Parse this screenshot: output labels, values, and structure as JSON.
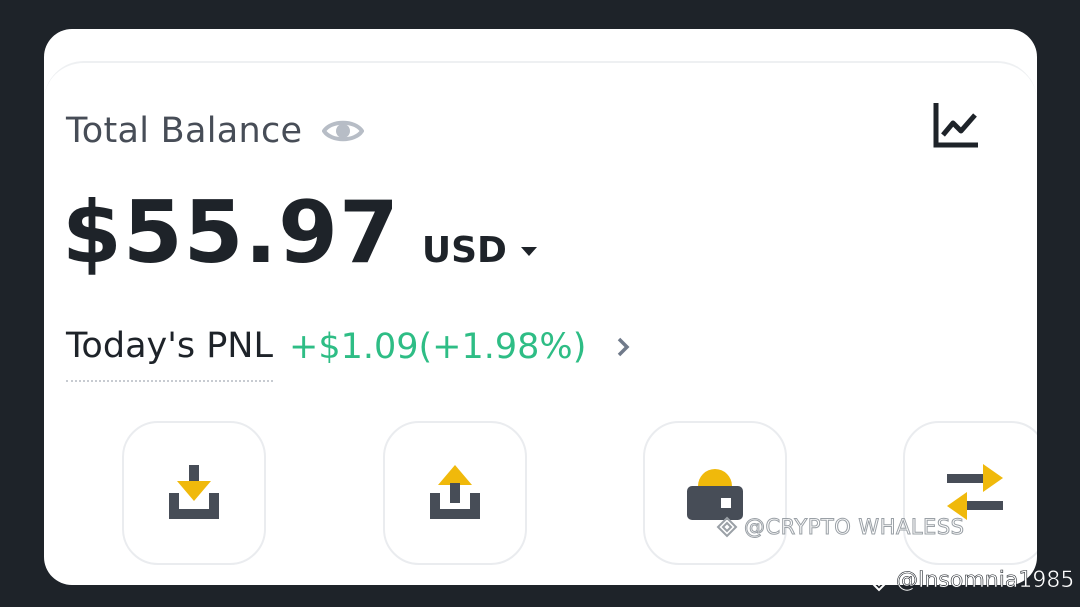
{
  "balance": {
    "label": "Total Balance",
    "amount": "$55.97",
    "currency": "USD"
  },
  "pnl": {
    "label": "Today's PNL",
    "value": "+$1.09(+1.98%)"
  },
  "colors": {
    "background": "#1e2329",
    "card": "#ffffff",
    "positive": "#2ebd85",
    "accent": "#f0b90b",
    "text": "#1e2329",
    "muted_icon": "#b7bdc6"
  },
  "icons": {
    "visibility": "eye-icon",
    "chart": "line-chart-icon",
    "currency_dropdown": "caret-down-icon",
    "pnl_details": "chevron-right-icon",
    "actions": [
      "deposit-icon",
      "withdraw-icon",
      "lock-icon",
      "transfer-icon"
    ]
  },
  "watermarks": {
    "primary": "@CRYPTO WHALESS",
    "secondary": "@Insomnia1985"
  }
}
